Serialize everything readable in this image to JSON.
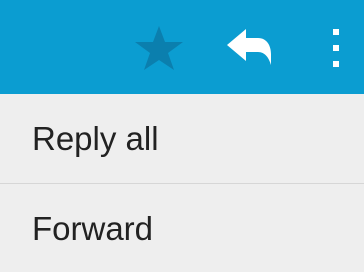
{
  "action_bar": {
    "icons": [
      "star-icon",
      "reply-icon",
      "overflow-menu-icon"
    ],
    "background_color": "#0b9dd1",
    "star_color": "#0b7fae",
    "icon_color": "#ffffff"
  },
  "menu": {
    "items": [
      {
        "label": "Reply all"
      },
      {
        "label": "Forward"
      }
    ],
    "background_color": "#eeeeee",
    "text_color": "#222222"
  }
}
